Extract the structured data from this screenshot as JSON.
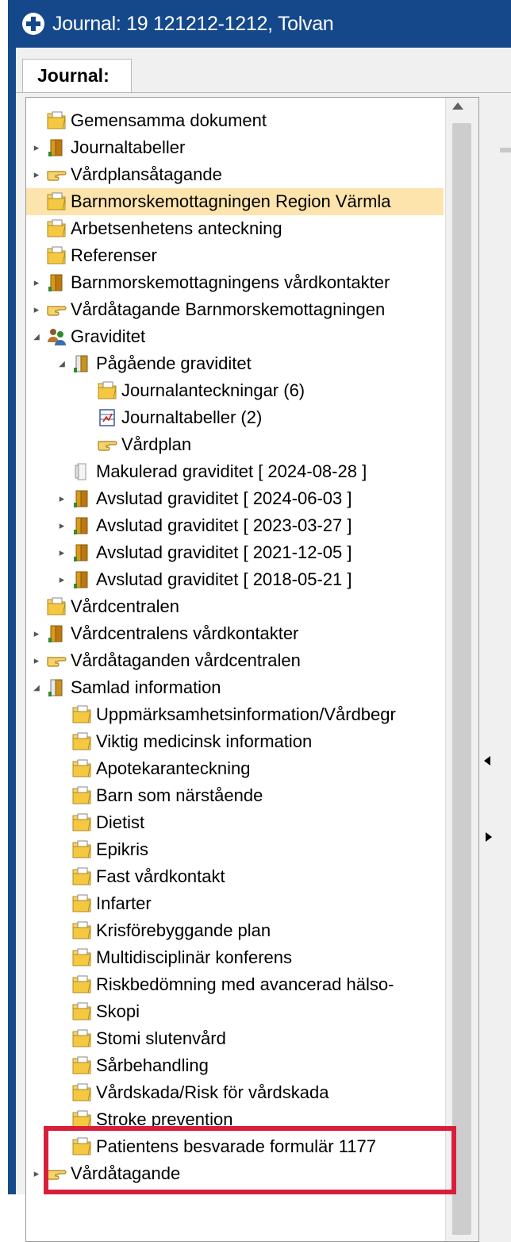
{
  "window": {
    "title": "Journal: 19 121212-1212, Tolvan"
  },
  "tabs": [
    {
      "label": "Journal:"
    }
  ],
  "colors": {
    "title_bar": "#15488a",
    "selected_row": "#fde4ad",
    "highlight_border": "#d81f3a"
  },
  "tree": [
    {
      "label": "Gemensamma dokument",
      "icon": "folder-doc-icon",
      "level": 0,
      "expander": "none"
    },
    {
      "label": "Journaltabeller",
      "icon": "book-icon",
      "level": 0,
      "expander": "collapsed"
    },
    {
      "label": "Vårdplansåtagande",
      "icon": "pointing-hand-icon",
      "level": 0,
      "expander": "collapsed"
    },
    {
      "label": "Barnmorskemottagningen Region Värmla",
      "icon": "folder-doc-icon",
      "level": 0,
      "expander": "none",
      "selected": true
    },
    {
      "label": "Arbetsenhetens anteckning",
      "icon": "folder-doc-icon",
      "level": 0,
      "expander": "none"
    },
    {
      "label": "Referenser",
      "icon": "folder-doc-icon",
      "level": 0,
      "expander": "none"
    },
    {
      "label": "Barnmorskemottagningens vårdkontakter",
      "icon": "book-icon",
      "level": 0,
      "expander": "collapsed"
    },
    {
      "label": "Vårdåtagande Barnmorskemottagningen",
      "icon": "pointing-hand-icon",
      "level": 0,
      "expander": "collapsed"
    },
    {
      "label": "Graviditet",
      "icon": "people-icon",
      "level": 0,
      "expander": "expanded"
    },
    {
      "label": "Pågående graviditet",
      "icon": "book-open-icon",
      "level": 1,
      "expander": "expanded"
    },
    {
      "label": "Journalanteckningar (6)",
      "icon": "folder-doc-icon",
      "level": 2,
      "expander": "none"
    },
    {
      "label": "Journaltabeller (2)",
      "icon": "table-doc-icon",
      "level": 2,
      "expander": "none"
    },
    {
      "label": "Vårdplan",
      "icon": "pointing-hand-icon",
      "level": 2,
      "expander": "none"
    },
    {
      "label": "Makulerad graviditet [ 2024-08-28 ]",
      "icon": "book-grey-icon",
      "level": 1,
      "expander": "none"
    },
    {
      "label": "Avslutad graviditet [ 2024-06-03 ]",
      "icon": "book-icon",
      "level": 1,
      "expander": "collapsed"
    },
    {
      "label": "Avslutad graviditet [ 2023-03-27 ]",
      "icon": "book-icon",
      "level": 1,
      "expander": "collapsed"
    },
    {
      "label": "Avslutad graviditet [ 2021-12-05 ]",
      "icon": "book-icon",
      "level": 1,
      "expander": "collapsed"
    },
    {
      "label": "Avslutad graviditet [ 2018-05-21 ]",
      "icon": "book-icon",
      "level": 1,
      "expander": "collapsed"
    },
    {
      "label": "Vårdcentralen",
      "icon": "folder-doc-icon",
      "level": 0,
      "expander": "none"
    },
    {
      "label": "Vårdcentralens vårdkontakter",
      "icon": "book-icon",
      "level": 0,
      "expander": "collapsed"
    },
    {
      "label": "Vårdåtaganden vårdcentralen",
      "icon": "pointing-hand-icon",
      "level": 0,
      "expander": "collapsed"
    },
    {
      "label": "Samlad information",
      "icon": "book-open-icon",
      "level": 0,
      "expander": "expanded"
    },
    {
      "label": "Uppmärksamhetsinformation/Vårdbegr",
      "icon": "folder-doc-icon",
      "level": 1,
      "expander": "none"
    },
    {
      "label": "Viktig medicinsk information",
      "icon": "folder-doc-icon",
      "level": 1,
      "expander": "none"
    },
    {
      "label": "Apotekaranteckning",
      "icon": "folder-doc-icon",
      "level": 1,
      "expander": "none"
    },
    {
      "label": "Barn som närstående",
      "icon": "folder-doc-icon",
      "level": 1,
      "expander": "none"
    },
    {
      "label": "Dietist",
      "icon": "folder-doc-icon",
      "level": 1,
      "expander": "none"
    },
    {
      "label": "Epikris",
      "icon": "folder-doc-icon",
      "level": 1,
      "expander": "none"
    },
    {
      "label": "Fast vårdkontakt",
      "icon": "folder-doc-icon",
      "level": 1,
      "expander": "none"
    },
    {
      "label": "Infarter",
      "icon": "folder-doc-icon",
      "level": 1,
      "expander": "none"
    },
    {
      "label": "Krisförebyggande plan",
      "icon": "folder-doc-icon",
      "level": 1,
      "expander": "none"
    },
    {
      "label": "Multidisciplinär konferens",
      "icon": "folder-doc-icon",
      "level": 1,
      "expander": "none"
    },
    {
      "label": "Riskbedömning med avancerad hälso-",
      "icon": "folder-doc-icon",
      "level": 1,
      "expander": "none"
    },
    {
      "label": "Skopi",
      "icon": "folder-doc-icon",
      "level": 1,
      "expander": "none"
    },
    {
      "label": "Stomi slutenvård",
      "icon": "folder-doc-icon",
      "level": 1,
      "expander": "none"
    },
    {
      "label": "Sårbehandling",
      "icon": "folder-doc-icon",
      "level": 1,
      "expander": "none"
    },
    {
      "label": "Vårdskada/Risk för vårdskada",
      "icon": "folder-doc-icon",
      "level": 1,
      "expander": "none"
    },
    {
      "label": "Stroke prevention",
      "icon": "folder-doc-icon",
      "level": 1,
      "expander": "none"
    },
    {
      "label": "Patientens besvarade formulär 1177",
      "icon": "folder-doc-icon",
      "level": 1,
      "expander": "none"
    },
    {
      "label": "Vårdåtagande",
      "icon": "pointing-hand-icon",
      "level": 0,
      "expander": "collapsed"
    }
  ]
}
